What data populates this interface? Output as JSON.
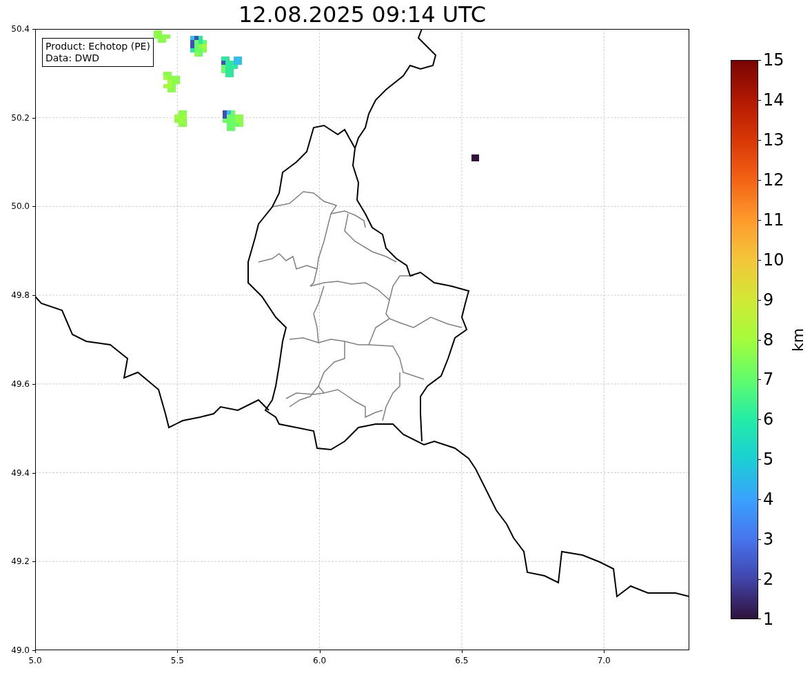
{
  "title": "12.08.2025 09:14 UTC",
  "map": {
    "legend": [
      "Product: Echotop (PE)",
      "Data: DWD"
    ],
    "x_tick_labels": [
      "5.0",
      "5.5",
      "6.0",
      "6.5",
      "7.0"
    ],
    "y_tick_labels": [
      "50.4",
      "50.2",
      "50.0",
      "49.8",
      "49.6",
      "49.4",
      "49.2",
      "49.0"
    ]
  },
  "colorbar": {
    "label": "km",
    "tick_labels": [
      "15",
      "14",
      "13",
      "12",
      "11",
      "10",
      "9",
      "8",
      "7",
      "6",
      "5",
      "4",
      "3",
      "2",
      "1"
    ]
  }
}
